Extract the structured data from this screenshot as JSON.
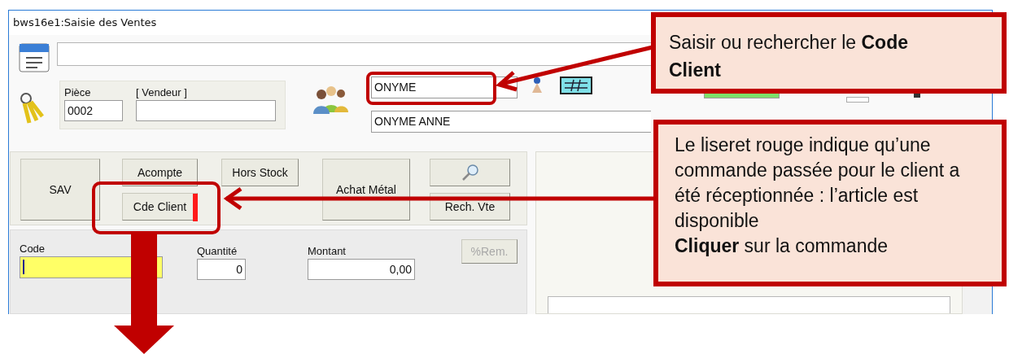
{
  "window": {
    "title": "bws16e1:Saisie des Ventes"
  },
  "header": {
    "piece": {
      "label": "Pièce",
      "value": "0002"
    },
    "vendeur": {
      "label": "[ Vendeur ]"
    },
    "client_code": "ONYME",
    "client_name": "ONYME ANNE"
  },
  "button_columns": [
    [
      {
        "kind": "tall",
        "label": "SAV"
      }
    ],
    [
      {
        "kind": "short",
        "label": "Acompte",
        "marker": false
      },
      {
        "kind": "short",
        "label": "Cde Client",
        "marker": true
      }
    ],
    [
      {
        "kind": "short",
        "label": "Hors Stock"
      }
    ],
    [
      {
        "kind": "tall",
        "label": "Achat Métal"
      }
    ],
    [
      {
        "kind": "icon"
      },
      {
        "kind": "short",
        "label": "Rech. Vte"
      }
    ]
  ],
  "entry": {
    "code": {
      "label": "Code",
      "focused": true
    },
    "quantite": {
      "label": "Quantité",
      "value": "0"
    },
    "montant": {
      "label": "Montant",
      "value": "0,00"
    },
    "remise_button": {
      "label": "%Rem.",
      "disabled": true
    }
  },
  "callouts": [
    {
      "text": "Saisir ou rechercher le **Code Client**"
    },
    {
      "text": "Le liseret rouge indique qu’une commande passée pour le client a été réceptionnée : l’article est disponible\n**Cliquer** sur la commande"
    }
  ]
}
